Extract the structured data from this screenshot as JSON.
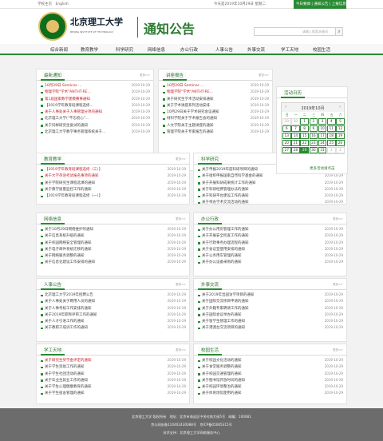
{
  "topbar": {
    "links": [
      "学校主页",
      "English"
    ],
    "date": "今天是2019年10月29日 星期二",
    "actions": "今日要闻 | 通知公告 | 上报信息"
  },
  "header": {
    "uni_name": "北京理工大学",
    "uni_en": "BEIJING INSTITUTE OF TECHNOLOGY",
    "title": "通知公告",
    "search_placeholder": "请输入搜索关键词",
    "search_icon": "search-icon"
  },
  "nav": [
    "综合新闻",
    "教育教学",
    "科学研究",
    "网络信息",
    "办公行政",
    "人事公告",
    "外事交流",
    "学工天地",
    "校园生活"
  ],
  "calendar": {
    "title": "活动日历",
    "month": "2019年10月",
    "weekdays": [
      "日",
      "一",
      "二",
      "三",
      "四",
      "五",
      "六"
    ],
    "days": [
      "29",
      "30",
      "1",
      "2",
      "3",
      "4",
      "5",
      "6",
      "7",
      "8",
      "9",
      "10",
      "11",
      "12",
      "13",
      "14",
      "15",
      "16",
      "17",
      "18",
      "19",
      "20",
      "21",
      "22",
      "23",
      "24",
      "25",
      "26",
      "27",
      "28",
      "29",
      "30",
      "31",
      "1",
      "2"
    ],
    "muted_idx": [
      0,
      1,
      33,
      34
    ],
    "today_idx": [
      30
    ],
    "more": "更多活动请点击"
  },
  "panels": [
    {
      "name": "panel-recent",
      "title": "最新通知",
      "items": [
        {
          "t": "10月29日 Seminar ...",
          "d": "2019-10-29",
          "red": true
        },
        {
          "t": "物理学院\"学术\"ANTHT-RE...",
          "d": "2019-10-29",
          "red": true
        },
        {
          "t": "第1届国家数学建模赛事通知",
          "d": "2019-10-29",
          "red": true
        },
        {
          "t": "【2019学年教育班课程选修...",
          "d": "2019-10-29",
          "red": false
        },
        {
          "t": "关于人事处关于人事管理分项的通知",
          "d": "2019-10-29",
          "red": true
        },
        {
          "t": "北京理工大学(\"不忘初心\"...",
          "d": "2019-10-29",
          "red": false
        },
        {
          "t": "关于同样研究生复试的通知",
          "d": "2019-10-29",
          "red": false
        },
        {
          "t": "北京理工大学教学事务管理系统关于...",
          "d": "2019-10-29",
          "red": false
        }
      ]
    },
    {
      "name": "panel-hot",
      "title": "讲座报告",
      "items": [
        {
          "t": "10月29日 Seminar ...",
          "d": "2019-10-29",
          "red": true
        },
        {
          "t": "物理学院\"学术\"ANTHT-RE...",
          "d": "2019-10-29",
          "red": true
        },
        {
          "t": "关于研究生学术活动安排通知",
          "d": "2019-10-29",
          "red": false
        },
        {
          "t": "关于学术讲座系列活动安排",
          "d": "2019-10-29",
          "red": false
        },
        {
          "t": "10月29日关于学术研究会议通知",
          "d": "2019-10-29",
          "red": false
        },
        {
          "t": "材料学院关于学术报告会的通知",
          "d": "2019-10-29",
          "red": false
        },
        {
          "t": "人文学院关于主题讲座的通知",
          "d": "2019-10-29",
          "red": false
        },
        {
          "t": "管理学院关于专家报告的通知",
          "d": "2019-10-29",
          "red": false
        }
      ]
    },
    {
      "name": "panel-teaching",
      "title": "教育教学",
      "items": [
        {
          "t": "【2019学年教育班课程选修（三）】",
          "d": "2019-10-29",
          "red": true
        },
        {
          "t": "关于大学英语考试报名事项的通知",
          "d": "2019-10-29",
          "red": true
        },
        {
          "t": "关于学院研究生课程选课的通知",
          "d": "2019-10-29",
          "red": false
        },
        {
          "t": "关于教学质量监控工作的通知",
          "d": "2019-10-29",
          "red": false
        },
        {
          "t": "【2019学年教育班课程选修（一）】",
          "d": "2019-10-29",
          "red": false
        }
      ]
    },
    {
      "name": "panel-research",
      "title": "科学研究",
      "items": [
        {
          "t": "关于申报2019年度科研项目的通知",
          "d": "2019-10-29",
          "red": false
        },
        {
          "t": "关于组织申报国家自然科学基金的通知",
          "d": "2019-10-29",
          "red": false
        },
        {
          "t": "关于开展科研成果统计工作的通知",
          "d": "2019-10-29",
          "red": false
        },
        {
          "t": "关于科研经费管理办法的通知",
          "d": "2019-10-29",
          "red": false
        },
        {
          "t": "关于科研平台建设工作的通知",
          "d": "2019-10-29",
          "red": false
        },
        {
          "t": "关于举办学术交流活动的通知",
          "d": "2019-10-29",
          "red": false
        }
      ]
    },
    {
      "name": "panel-network",
      "title": "网络信息",
      "items": [
        {
          "t": "关于10月29日网络维护的通知",
          "d": "2019-10-29",
          "red": false
        },
        {
          "t": "关于信息系统升级的通知",
          "d": "2019-10-29",
          "red": false
        },
        {
          "t": "关于校园网络安全管理的通知",
          "d": "2019-10-29",
          "red": false
        },
        {
          "t": "关于电子邮件系统迁移的通知",
          "d": "2019-10-29",
          "red": false
        },
        {
          "t": "关于网络服务调整的通知",
          "d": "2019-10-29",
          "red": false
        },
        {
          "t": "关于信息化建设工作安排的通知",
          "d": "2019-10-29",
          "red": false
        }
      ]
    },
    {
      "name": "panel-office",
      "title": "办公行政",
      "items": [
        {
          "t": "关于办公用房管理工作的通知",
          "d": "2019-10-29",
          "red": false
        },
        {
          "t": "关于开展安全检查工作的通知",
          "d": "2019-10-29",
          "red": false
        },
        {
          "t": "关于行政事务办理流程的通知",
          "d": "2019-10-29",
          "red": false
        },
        {
          "t": "关于会议室使用安排的通知",
          "d": "2019-10-29",
          "red": false
        },
        {
          "t": "关于公务用车管理的通知",
          "d": "2019-10-29",
          "red": false
        },
        {
          "t": "关于办公设备采购的通知",
          "d": "2019-10-29",
          "red": false
        }
      ]
    },
    {
      "name": "panel-personnel",
      "title": "人事公告",
      "items": [
        {
          "t": "北京理工大学2019年招聘公告",
          "d": "2019-10-29",
          "red": false
        },
        {
          "t": "关于人事处关于聘用人员的通知",
          "d": "2019-10-29",
          "red": false
        },
        {
          "t": "关于人事考核工作安排的通知",
          "d": "2019-10-29",
          "red": false
        },
        {
          "t": "关于2019年职称评审工作的通知",
          "d": "2019-10-29",
          "red": false
        },
        {
          "t": "关于人才引进工作的通知",
          "d": "2019-10-29",
          "red": false
        },
        {
          "t": "关于教职工培训工作的通知",
          "d": "2019-10-29",
          "red": false
        }
      ]
    },
    {
      "name": "panel-foreign",
      "title": "外事交流",
      "items": [
        {
          "t": "关于2019年出国访学项目的通知",
          "d": "2019-10-29",
          "red": false
        },
        {
          "t": "关于国际交流项目申请的通知",
          "d": "2019-10-29",
          "red": false
        },
        {
          "t": "关于外籍专家聘请工作的通知",
          "d": "2019-10-29",
          "red": false
        },
        {
          "t": "关于国际会议举办的通知",
          "d": "2019-10-29",
          "red": false
        },
        {
          "t": "关于留学生管理工作的通知",
          "d": "2019-10-29",
          "red": false
        },
        {
          "t": "关于港澳台交流项目的通知",
          "d": "2019-10-29",
          "red": false
        }
      ]
    },
    {
      "name": "panel-students",
      "title": "学工天地",
      "items": [
        {
          "t": "关于研究生奖学金评定的通知",
          "d": "2019-10-29",
          "red": true
        },
        {
          "t": "关于学生资助工作的通知",
          "d": "2019-10-29",
          "red": false
        },
        {
          "t": "关于学生社团活动的通知",
          "d": "2019-10-29",
          "red": false
        },
        {
          "t": "关于毕业生就业工作的通知",
          "d": "2019-10-29",
          "red": false
        },
        {
          "t": "关于学生心理健康教育的通知",
          "d": "2019-10-29",
          "red": false
        },
        {
          "t": "关于学生宿舍管理的通知",
          "d": "2019-10-29",
          "red": false
        }
      ]
    },
    {
      "name": "panel-campus",
      "title": "校园生活",
      "items": [
        {
          "t": "关于校园文化活动的通知",
          "d": "2019-10-29",
          "red": false
        },
        {
          "t": "关于食堂服务调整的通知",
          "d": "2019-10-29",
          "red": false
        },
        {
          "t": "关于校园交通管理的通知",
          "d": "2019-10-29",
          "red": false
        },
        {
          "t": "关于图书馆开放时间的通知",
          "d": "2019-10-29",
          "red": false
        },
        {
          "t": "关于校园环境整治的通知",
          "d": "2019-10-29",
          "red": false
        },
        {
          "t": "关于体育场馆使用的通知",
          "d": "2019-10-29",
          "red": false
        }
      ]
    }
  ],
  "more_label": "更多>>",
  "footer": {
    "line1": "北京理工大学 版权所有　地址：北京市海淀区中关村南大街5号　邮编：100081",
    "line2": "京公网安备110402430088号　京ICP备05065315号",
    "line3": "技术支持：北京理工大学网络服务中心"
  }
}
